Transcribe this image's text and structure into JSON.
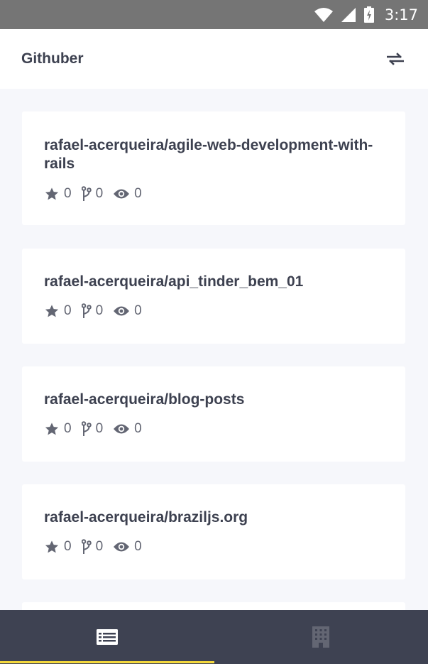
{
  "status_bar": {
    "time": "3:17",
    "icons": [
      "wifi-icon",
      "cell-signal-icon",
      "battery-charging-icon"
    ]
  },
  "app_bar": {
    "title": "Githuber",
    "action_icon": "swap-icon"
  },
  "repos": [
    {
      "name": "rafael-acerqueira/agile-web-development-with-rails",
      "stars": "0",
      "forks": "0",
      "watchers": "0"
    },
    {
      "name": "rafael-acerqueira/api_tinder_bem_01",
      "stars": "0",
      "forks": "0",
      "watchers": "0"
    },
    {
      "name": "rafael-acerqueira/blog-posts",
      "stars": "0",
      "forks": "0",
      "watchers": "0"
    },
    {
      "name": "rafael-acerqueira/braziljs.org",
      "stars": "0",
      "forks": "0",
      "watchers": "0"
    }
  ],
  "stat_icons": [
    "star-icon",
    "fork-icon",
    "eye-icon"
  ],
  "bottom_nav": {
    "tabs": [
      {
        "icon": "list-icon",
        "active": true
      },
      {
        "icon": "building-icon",
        "active": false
      }
    ]
  },
  "colors": {
    "accent": "#f5d93c",
    "bottom_nav_bg": "#3e4252",
    "title_text": "#3d4150",
    "page_bg": "#f6f7fb"
  }
}
